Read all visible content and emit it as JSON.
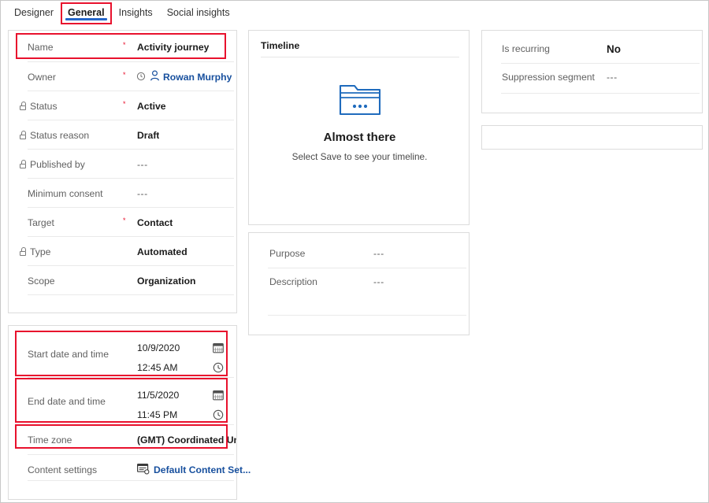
{
  "tabs": [
    {
      "label": "Designer",
      "selected": false
    },
    {
      "label": "General",
      "selected": true
    },
    {
      "label": "Insights",
      "selected": false
    },
    {
      "label": "Social insights",
      "selected": false
    }
  ],
  "main_card": {
    "fields": [
      {
        "label": "Name",
        "value": "Activity journey",
        "required": "*",
        "locked": false
      },
      {
        "label": "Owner",
        "value": "Rowan Murphy",
        "required": "*",
        "locked": false
      },
      {
        "label": "Status",
        "value": "Active",
        "required": "*",
        "locked": true
      },
      {
        "label": "Status reason",
        "value": "Draft",
        "required": "",
        "locked": true
      },
      {
        "label": "Published by",
        "value": "---",
        "required": "",
        "locked": true
      },
      {
        "label": "Minimum consent",
        "value": "---",
        "required": "",
        "locked": false
      },
      {
        "label": "Target",
        "value": "Contact",
        "required": "*",
        "locked": false
      },
      {
        "label": "Type",
        "value": "Automated",
        "required": "",
        "locked": true
      },
      {
        "label": "Scope",
        "value": "Organization",
        "required": "",
        "locked": false
      }
    ]
  },
  "dates_card": {
    "start": {
      "label": "Start date and time",
      "date": "10/9/2020",
      "time": "12:45 AM"
    },
    "end": {
      "label": "End date and time",
      "date": "11/5/2020",
      "time": "11:45 PM"
    },
    "timezone": {
      "label": "Time zone",
      "value": "(GMT) Coordinated Universal Time"
    },
    "content_settings": {
      "label": "Content settings",
      "value": "Default Content Set..."
    }
  },
  "timeline": {
    "title": "Timeline",
    "empty_title": "Almost there",
    "empty_subtitle": "Select Save to see your timeline."
  },
  "purpose_card": {
    "fields": [
      {
        "label": "Purpose",
        "value": "---"
      },
      {
        "label": "Description",
        "value": "---"
      }
    ]
  },
  "right_card": {
    "fields": [
      {
        "label": "Is recurring",
        "value": "No"
      },
      {
        "label": "Suppression segment",
        "value": "---"
      }
    ]
  },
  "icons": {
    "lock": "lock-icon",
    "presence": "presence-icon",
    "person": "person-icon",
    "calendar": "calendar-icon",
    "clock": "clock-icon",
    "content_settings": "content-settings-icon",
    "folder": "folder-icon"
  },
  "colors": {
    "accent": "#2566c9",
    "link": "#18509e",
    "highlight": "#e8112d",
    "required": "#e8112d",
    "label": "#616161",
    "value": "#1b1b1b",
    "card_border": "#dcdcdc",
    "divider": "#eaeaea"
  }
}
